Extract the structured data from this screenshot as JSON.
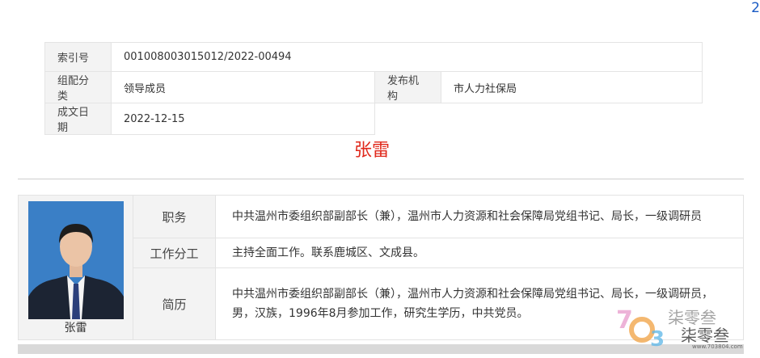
{
  "corner_number": "2",
  "meta": {
    "index_label": "索引号",
    "index_value": "001008003015012/2022-00494",
    "category_label": "组配分类",
    "category_value": "领导成员",
    "publisher_label": "发布机构",
    "publisher_value": "市人力社保局",
    "date_label": "成文日期",
    "date_value": "2022-12-15"
  },
  "title": "张雷",
  "leader": {
    "photo_name": "张雷",
    "position_label": "职务",
    "position_value": "中共温州市委组织部副部长（兼），温州市人力资源和社会保障局党组书记、局长，一级调研员",
    "duty_label": "工作分工",
    "duty_value": "主持全面工作。联系鹿城区、文成县。",
    "resume_label": "简历",
    "resume_value": "中共温州市委组织部副部长（兼），温州市人力资源和社会保障局党组书记、局长，一级调研员，男，汉族，1996年8月参加工作，研究生学历，中共党员。"
  },
  "watermark": {
    "brand_top": "柒零叁",
    "brand_bottom": "柒零叁",
    "url": "www.703804.com"
  }
}
